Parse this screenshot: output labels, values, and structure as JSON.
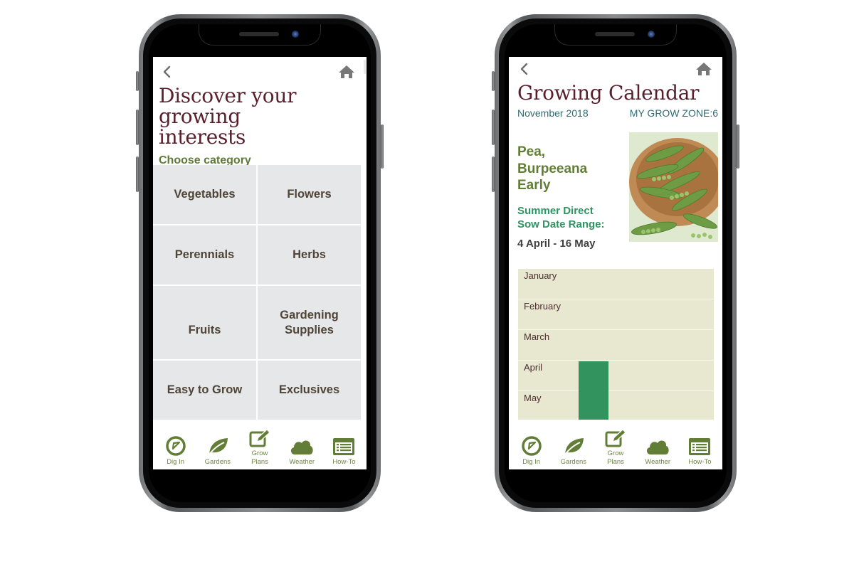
{
  "left_screen": {
    "back_icon": "chevron-left-icon",
    "home_icon": "home-icon",
    "title": "Discover your growing interests",
    "title_line1": "Discover your growing",
    "title_line2": "interests",
    "subtitle": "Choose category",
    "categories": [
      {
        "label": "Vegetables"
      },
      {
        "label": "Flowers"
      },
      {
        "label": "Perennials"
      },
      {
        "label": "Herbs"
      },
      {
        "label": "Fruits"
      },
      {
        "label": "Gardening Supplies",
        "line1": "Gardening",
        "line2": "Supplies"
      },
      {
        "label": "Easy to Grow"
      },
      {
        "label": "Exclusives"
      }
    ]
  },
  "right_screen": {
    "back_icon": "chevron-left-icon",
    "home_icon": "home-icon",
    "title": "Growing Calendar",
    "date": "November 2018",
    "grow_zone": "MY GROW ZONE:6",
    "plant_name_line1": "Pea,",
    "plant_name_line2": "Burpeeana",
    "plant_name_line3": "Early",
    "sow_label_line1": "Summer Direct",
    "sow_label_line2": "Sow Date Range:",
    "sow_range": "4 April - 16 May",
    "photo_alt": "peas in wooden bowl",
    "calendar": {
      "months": [
        "January",
        "February",
        "March",
        "April",
        "May"
      ],
      "sow_start": {
        "month": "April",
        "day": 4
      },
      "sow_end": {
        "month": "May",
        "day": 16
      },
      "bar_color": "#33935f"
    }
  },
  "tabbar": [
    {
      "label": "Dig In",
      "icon": "compass-icon"
    },
    {
      "label": "Gardens",
      "icon": "leaf-icon"
    },
    {
      "label": "Grow Plans",
      "line1": "Grow",
      "line2": "Plans",
      "icon": "edit-icon"
    },
    {
      "label": "Weather",
      "icon": "cloud-icon"
    },
    {
      "label": "How-To",
      "icon": "list-icon"
    }
  ],
  "colors": {
    "title": "#5a1f2c",
    "accent_green": "#627d36",
    "sow_green": "#2e9461",
    "teal": "#2d6b73",
    "tile_bg": "#e5e7e8",
    "calendar_bg": "#e8e7d0"
  }
}
